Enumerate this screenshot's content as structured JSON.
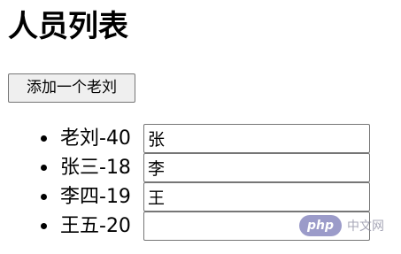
{
  "page": {
    "title": "人员列表"
  },
  "actions": {
    "add_label": "添加一个老刘"
  },
  "people": [
    {
      "label": "老刘-40",
      "input_value": "张"
    },
    {
      "label": "张三-18",
      "input_value": "李"
    },
    {
      "label": "李四-19",
      "input_value": "王"
    },
    {
      "label": "王五-20",
      "input_value": ""
    }
  ],
  "watermark": {
    "badge": "php",
    "text": "中文网"
  }
}
